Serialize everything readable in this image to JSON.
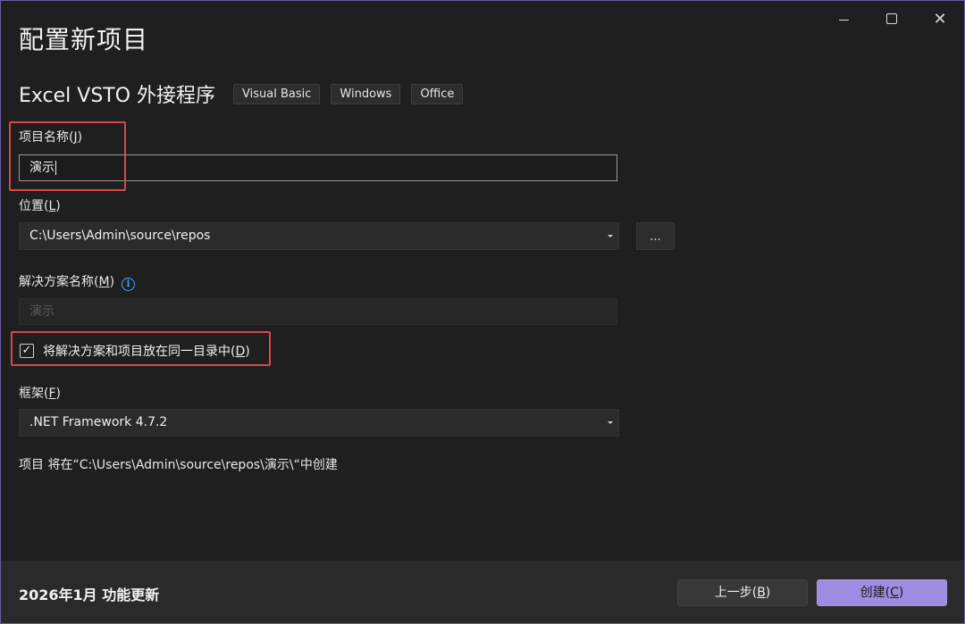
{
  "window": {
    "title": "配置新项目",
    "controls": {
      "minimize": "minimize",
      "maximize": "maximize",
      "close": "✕"
    }
  },
  "project_type": {
    "name": "Excel VSTO 外接程序",
    "tags": [
      "Visual Basic",
      "Windows",
      "Office"
    ]
  },
  "project_name": {
    "label_prefix": "项目名称(",
    "label_key": "J",
    "label_suffix": ")",
    "value": "演示"
  },
  "location": {
    "label_prefix": "位置(",
    "label_key": "L",
    "label_suffix": ")",
    "value": "C:\\Users\\Admin\\source\\repos",
    "browse_label": "..."
  },
  "solution_name": {
    "label_prefix": "解决方案名称(",
    "label_key": "M",
    "label_suffix": ")",
    "info_icon": "i",
    "value": "演示"
  },
  "same_dir": {
    "checked": true,
    "check_glyph": "✓",
    "label_prefix": "将解决方案和项目放在同一目录中(",
    "label_key": "D",
    "label_suffix": ")"
  },
  "framework": {
    "label_prefix": "框架(",
    "label_key": "F",
    "label_suffix": ")",
    "value": ".NET Framework 4.7.2"
  },
  "path_note": "项目 将在“C:\\Users\\Admin\\source\\repos\\演示\\“中创建",
  "footer": {
    "update_text": "2026年1月 功能更新",
    "back_prefix": "上一步(",
    "back_key": "B",
    "back_suffix": ")",
    "create_prefix": "创建(",
    "create_key": "C",
    "create_suffix": ")"
  },
  "colors": {
    "accent": "#9d8ce0",
    "highlight": "#d94848",
    "info": "#4fa3ff",
    "background": "#1f1f1f"
  }
}
